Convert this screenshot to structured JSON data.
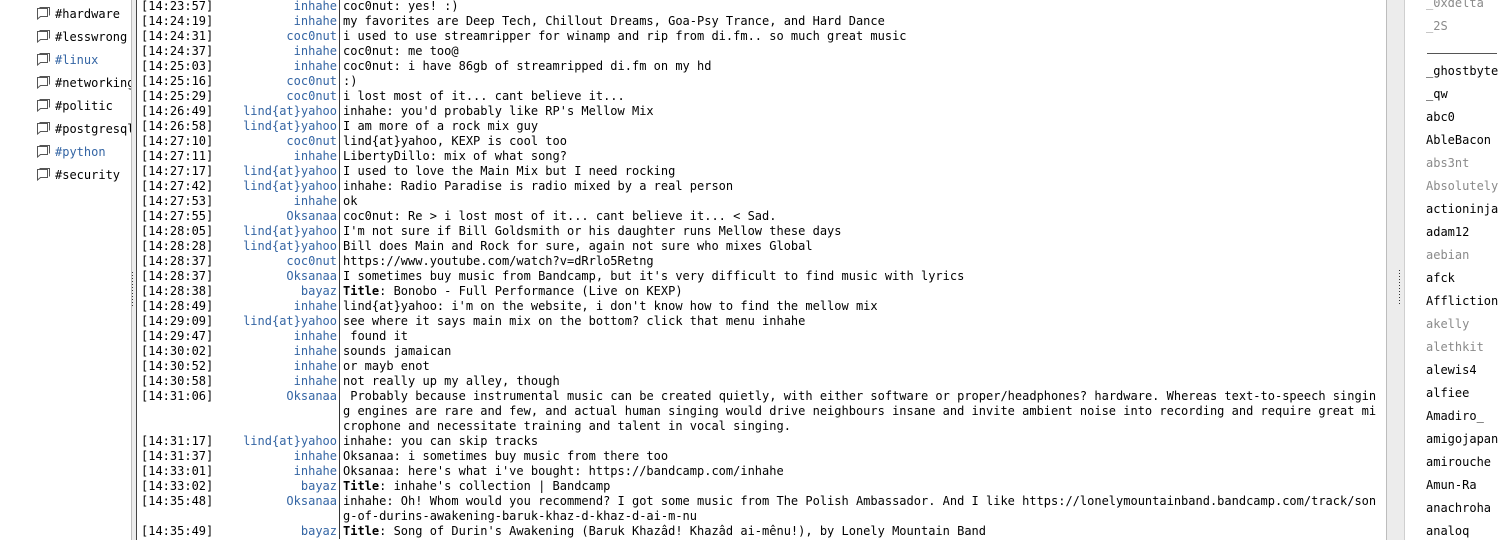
{
  "channels": [
    {
      "name": "#hardware",
      "active": false
    },
    {
      "name": "#lesswrong",
      "active": false
    },
    {
      "name": "#linux",
      "active": true
    },
    {
      "name": "#networking",
      "active": false
    },
    {
      "name": "#politic",
      "active": false
    },
    {
      "name": "#postgresql",
      "active": false
    },
    {
      "name": "#python",
      "active": true
    },
    {
      "name": "#security",
      "active": false
    }
  ],
  "messages": [
    {
      "time": "[14:23:57]",
      "nick": "inhahe",
      "text": "coc0nut: yes! :)"
    },
    {
      "time": "[14:24:19]",
      "nick": "inhahe",
      "text": "my favorites are Deep Tech, Chillout Dreams, Goa-Psy Trance, and Hard Dance"
    },
    {
      "time": "[14:24:31]",
      "nick": "coc0nut",
      "text": "i used to use streamripper for winamp and rip from di.fm.. so much great music"
    },
    {
      "time": "[14:24:37]",
      "nick": "inhahe",
      "text": "coc0nut: me too@"
    },
    {
      "time": "[14:25:03]",
      "nick": "inhahe",
      "text": "coc0nut: i have 86gb of streamripped di.fm on my hd"
    },
    {
      "time": "[14:25:16]",
      "nick": "coc0nut",
      "text": ":)"
    },
    {
      "time": "[14:25:29]",
      "nick": "coc0nut",
      "text": "i lost most of it... cant believe it..."
    },
    {
      "time": "[14:26:49]",
      "nick": "lind{at}yahoo",
      "text": "inhahe: you'd probably like RP's Mellow Mix"
    },
    {
      "time": "[14:26:58]",
      "nick": "lind{at}yahoo",
      "text": "I am more of a rock mix guy"
    },
    {
      "time": "[14:27:10]",
      "nick": "coc0nut",
      "text": "lind{at}yahoo, KEXP is cool too"
    },
    {
      "time": "[14:27:11]",
      "nick": "inhahe",
      "text": "LibertyDillo: mix of what song?"
    },
    {
      "time": "[14:27:17]",
      "nick": "lind{at}yahoo",
      "text": "I used to love the Main Mix but I need rocking"
    },
    {
      "time": "[14:27:42]",
      "nick": "lind{at}yahoo",
      "text": "inhahe: Radio Paradise is radio mixed by a real person"
    },
    {
      "time": "[14:27:53]",
      "nick": "inhahe",
      "text": "ok"
    },
    {
      "time": "[14:27:55]",
      "nick": "Oksanaa",
      "text": "coc0nut: Re > i lost most of it... cant believe it... < Sad."
    },
    {
      "time": "[14:28:05]",
      "nick": "lind{at}yahoo",
      "text": "I'm not sure if Bill Goldsmith or his daughter runs Mellow these days"
    },
    {
      "time": "[14:28:28]",
      "nick": "lind{at}yahoo",
      "text": "Bill does Main and Rock for sure, again not sure who mixes Global"
    },
    {
      "time": "[14:28:37]",
      "nick": "coc0nut",
      "text": "https://www.youtube.com/watch?v=dRrlo5Retng"
    },
    {
      "time": "[14:28:37]",
      "nick": "Oksanaa",
      "text": "I sometimes buy music from Bandcamp, but it's very difficult to find music with lyrics"
    },
    {
      "time": "[14:28:38]",
      "nick": "bayaz",
      "title": "Title",
      "text": ": Bonobo - Full Performance (Live on KEXP)"
    },
    {
      "time": "[14:28:49]",
      "nick": "inhahe",
      "text": "lind{at}yahoo: i'm on the website, i don't know how to find the mellow mix"
    },
    {
      "time": "[14:29:09]",
      "nick": "lind{at}yahoo",
      "text": "see where it says main mix on the bottom? click that menu inhahe"
    },
    {
      "time": "[14:29:47]",
      "nick": "inhahe",
      "text": " found it"
    },
    {
      "time": "[14:30:02]",
      "nick": "inhahe",
      "text": "sounds jamaican"
    },
    {
      "time": "[14:30:52]",
      "nick": "inhahe",
      "text": "or mayb enot"
    },
    {
      "time": "[14:30:58]",
      "nick": "inhahe",
      "text": "not really up my alley, though"
    },
    {
      "time": "[14:31:06]",
      "nick": "Oksanaa",
      "text": " Probably because instrumental music can be created quietly, with either software or proper/headphones? hardware. Whereas text-to-speech singing engines are rare and few, and actual human singing would drive neighbours insane and invite ambient noise into recording and require great microphone and necessitate training and talent in vocal singing."
    },
    {
      "time": "[14:31:17]",
      "nick": "lind{at}yahoo",
      "text": "inhahe: you can skip tracks"
    },
    {
      "time": "[14:31:37]",
      "nick": "inhahe",
      "text": "Oksanaa: i sometimes buy music from there too"
    },
    {
      "time": "[14:33:01]",
      "nick": "inhahe",
      "text": "Oksanaa: here's what i've bought: https://bandcamp.com/inhahe"
    },
    {
      "time": "[14:33:02]",
      "nick": "bayaz",
      "title": "Title",
      "text": ": inhahe's collection | Bandcamp"
    },
    {
      "time": "[14:35:48]",
      "nick": "Oksanaa",
      "text": "inhahe: Oh! Whom would you recommend? I got some music from The Polish Ambassador. And I like https://lonelymountainband.bandcamp.com/track/song-of-durins-awakening-baruk-khaz-d-khaz-d-ai-m-nu"
    },
    {
      "time": "[14:35:49]",
      "nick": "bayaz",
      "title": "Title",
      "text": ": Song of Durin's Awakening (Baruk Khazâd! Khazâd ai-mênu!), by Lonely Mountain Band"
    }
  ],
  "users_top": [
    {
      "name": "_0xdelta",
      "away": true
    },
    {
      "name": "_2S",
      "away": true
    }
  ],
  "users": [
    {
      "name": "_ghostbyte",
      "away": false
    },
    {
      "name": "_qw",
      "away": false
    },
    {
      "name": "abc0",
      "away": false
    },
    {
      "name": "AbleBacon",
      "away": false
    },
    {
      "name": "abs3nt",
      "away": true
    },
    {
      "name": "Absolutely",
      "away": true
    },
    {
      "name": "actioninja",
      "away": false
    },
    {
      "name": "adam12",
      "away": false
    },
    {
      "name": "aebian",
      "away": true
    },
    {
      "name": "afck",
      "away": false
    },
    {
      "name": "Affliction",
      "away": false
    },
    {
      "name": "akelly",
      "away": true
    },
    {
      "name": "alethkit",
      "away": true
    },
    {
      "name": "alewis4",
      "away": false
    },
    {
      "name": "alfiee",
      "away": false
    },
    {
      "name": "Amadiro_",
      "away": false
    },
    {
      "name": "amigojapan",
      "away": false
    },
    {
      "name": "amirouche",
      "away": false
    },
    {
      "name": "Amun-Ra",
      "away": false
    },
    {
      "name": "anachroha",
      "away": false
    },
    {
      "name": "analoq",
      "away": false
    }
  ]
}
